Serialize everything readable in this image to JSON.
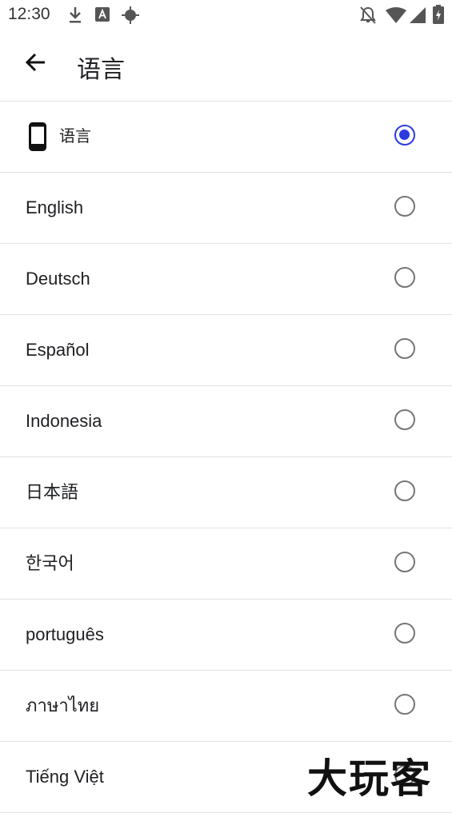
{
  "status_bar": {
    "time": "12:30",
    "icons": [
      "download-icon",
      "font-a-icon",
      "gps-icon",
      "notifications-off-icon",
      "wifi-icon",
      "signal-icon",
      "battery-icon"
    ]
  },
  "header": {
    "back_icon": "arrow-left-icon",
    "title": "语言"
  },
  "languages": [
    {
      "label": "语言",
      "icon": "phone-icon",
      "selected": true
    },
    {
      "label": "English",
      "selected": false
    },
    {
      "label": "Deutsch",
      "selected": false
    },
    {
      "label": "Español",
      "selected": false
    },
    {
      "label": "Indonesia",
      "selected": false
    },
    {
      "label": "日本語",
      "selected": false
    },
    {
      "label": "한국어",
      "selected": false
    },
    {
      "label": "português",
      "selected": false
    },
    {
      "label": "ภาษาไทย",
      "selected": false
    },
    {
      "label": "Tiếng Việt",
      "selected": false
    }
  ],
  "watermark": "大玩客",
  "colors": {
    "accent": "#2b3be0",
    "radio_off": "#757575",
    "divider": "#e2e2e2"
  }
}
